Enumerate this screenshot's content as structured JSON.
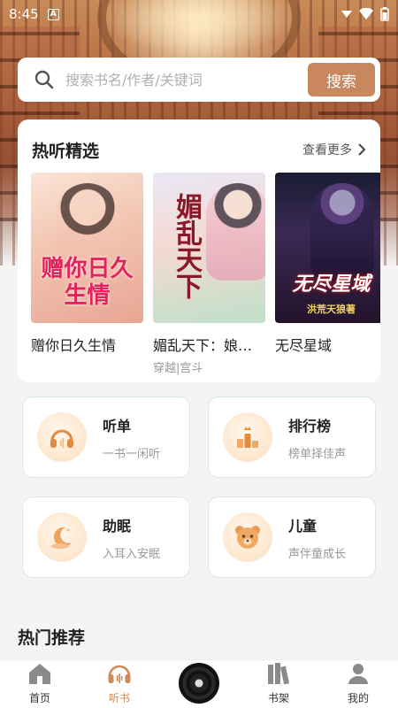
{
  "status_bar": {
    "time": "8:45",
    "notification": "A"
  },
  "search": {
    "placeholder": "搜索书名/作者/关键词",
    "value": "",
    "button_label": "搜索"
  },
  "hot": {
    "title": "热听精选",
    "see_more": "查看更多",
    "books": [
      {
        "title": "赠你日久生情",
        "tags": "",
        "cover_text": "赠你日久生情"
      },
      {
        "title": "媚乱天下：娘娘要出墙",
        "title_display": "媚乱天下：娘娘...",
        "tags": "穿越|宫斗",
        "cover_text": "媚乱天下"
      },
      {
        "title": "无尽星域",
        "tags": "",
        "cover_text": "无尽星域",
        "cover_sub": "洪荒天狼著"
      }
    ]
  },
  "categories": [
    {
      "name": "听单",
      "desc": "一书一闲听",
      "icon": "headphones-icon"
    },
    {
      "name": "排行榜",
      "desc": "榜单择佳声",
      "icon": "ranking-icon"
    },
    {
      "name": "助眠",
      "desc": "入耳入安眠",
      "icon": "moon-icon"
    },
    {
      "name": "儿童",
      "desc": "声伴童成长",
      "icon": "bear-icon"
    }
  ],
  "recommend": {
    "title": "热门推荐"
  },
  "nav": [
    {
      "label": "首页",
      "icon": "home-icon",
      "active": false
    },
    {
      "label": "听书",
      "icon": "headphones-icon",
      "active": true
    },
    {
      "label": "",
      "icon": "vinyl-record-icon",
      "active": false
    },
    {
      "label": "书架",
      "icon": "bookshelf-icon",
      "active": false
    },
    {
      "label": "我的",
      "icon": "profile-icon",
      "active": false
    }
  ],
  "colors": {
    "accent": "#c8875c",
    "active_nav": "#d08a57",
    "tile_border": "#d7ecd8"
  }
}
